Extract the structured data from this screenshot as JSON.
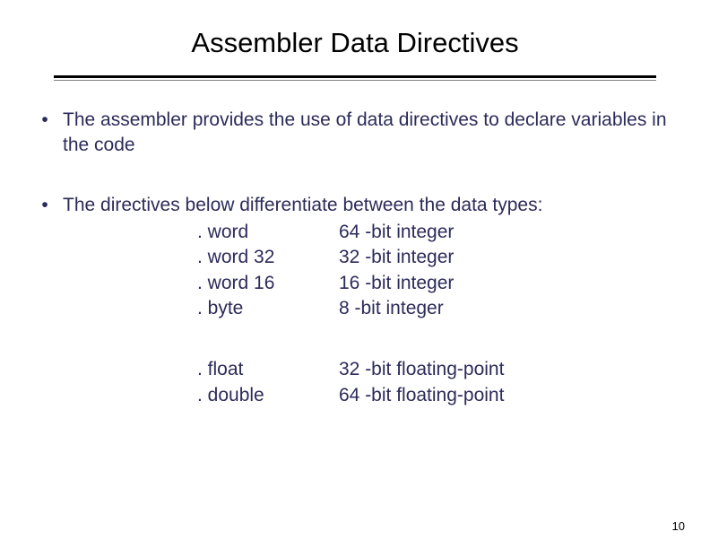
{
  "title": "Assembler Data Directives",
  "bullets": {
    "b0": {
      "marker": "•",
      "text": "The assembler provides the use of data directives to declare variables in the code"
    },
    "b1": {
      "marker": "•",
      "text": "The directives below differentiate between the data types:"
    }
  },
  "directives_int": [
    {
      "name": ". word",
      "desc": "64 -bit integer"
    },
    {
      "name": ". word 32",
      "desc": "32 -bit integer"
    },
    {
      "name": ". word 16",
      "desc": "16 -bit integer"
    },
    {
      "name": ". byte",
      "desc": "8 -bit integer"
    }
  ],
  "directives_float": [
    {
      "name": ". float",
      "desc": "32 -bit floating-point"
    },
    {
      "name": ". double",
      "desc": "64 -bit floating-point"
    }
  ],
  "page_number": "10"
}
